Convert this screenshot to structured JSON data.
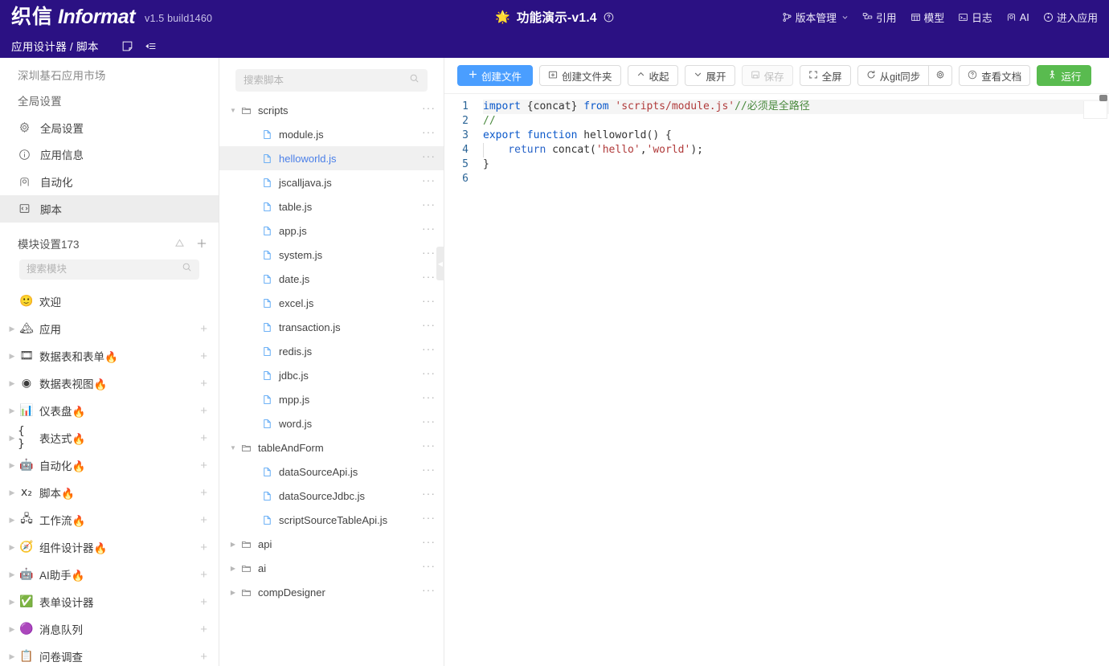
{
  "header": {
    "logo_cn": "织信",
    "logo_en": "Informat",
    "version": "v1.5 build1460",
    "center_star": "🌟",
    "center_title": "功能演示-v1.4",
    "help_icon": "help-circle-icon",
    "nav": [
      {
        "label": "版本管理",
        "icon": "branch-icon",
        "has_chevron": true
      },
      {
        "label": "引用",
        "icon": "reference-icon",
        "has_chevron": false
      },
      {
        "label": "模型",
        "icon": "model-table-icon",
        "has_chevron": false
      },
      {
        "label": "日志",
        "icon": "log-icon",
        "has_chevron": false
      },
      {
        "label": "AI",
        "icon": "ai-icon",
        "has_chevron": false
      },
      {
        "label": "进入应用",
        "icon": "enter-app-icon",
        "has_chevron": false
      }
    ],
    "brand_bg": "#2b1183"
  },
  "breadcrumb": {
    "text": "应用设计器 / 脚本",
    "icons": [
      "note-icon",
      "layout-toggle-icon"
    ]
  },
  "sidebar": {
    "market_name": "深圳基石应用市场",
    "section_label": "全局设置",
    "nav_items": [
      {
        "label": "全局设置",
        "icon": "gear-icon",
        "active": false
      },
      {
        "label": "应用信息",
        "icon": "info-icon",
        "active": false
      },
      {
        "label": "自动化",
        "icon": "robot-icon",
        "active": false
      },
      {
        "label": "脚本",
        "icon": "code-file-icon",
        "active": true
      }
    ],
    "modules_title": "模块设置173",
    "modules_head_icons": [
      "warning-triangle-icon",
      "plus-icon"
    ],
    "search_placeholder": "搜索模块",
    "search_value": "",
    "modules": [
      {
        "label": "欢迎",
        "emoji": "🙂",
        "caret": false,
        "plus": false
      },
      {
        "label": "应用",
        "emoji": "🏔",
        "caret": true,
        "plus": true
      },
      {
        "label": "数据表和表单🔥",
        "emoji": "🎞",
        "caret": true,
        "plus": true
      },
      {
        "label": "数据表视图🔥",
        "emoji": "◉",
        "caret": true,
        "plus": true
      },
      {
        "label": "仪表盘🔥",
        "emoji": "📊",
        "caret": true,
        "plus": true
      },
      {
        "label": "表达式🔥",
        "emoji": "{ }",
        "caret": true,
        "plus": true
      },
      {
        "label": "自动化🔥",
        "emoji": "🤖",
        "caret": true,
        "plus": true
      },
      {
        "label": "脚本🔥",
        "emoji": "x₂",
        "caret": true,
        "plus": true
      },
      {
        "label": "工作流🔥",
        "emoji": "🖧",
        "caret": true,
        "plus": true
      },
      {
        "label": "组件设计器🔥",
        "emoji": "🧭",
        "caret": true,
        "plus": true
      },
      {
        "label": "AI助手🔥",
        "emoji": "🤖",
        "caret": true,
        "plus": true
      },
      {
        "label": "表单设计器",
        "emoji": "✅",
        "caret": true,
        "plus": true
      },
      {
        "label": "消息队列",
        "emoji": "🟣",
        "caret": true,
        "plus": true
      },
      {
        "label": "问卷调查",
        "emoji": "📋",
        "caret": true,
        "plus": true
      }
    ]
  },
  "filetree": {
    "search_placeholder": "搜索脚本",
    "search_value": "",
    "nodes": [
      {
        "name": "scripts",
        "type": "folder",
        "depth": 0,
        "expanded": true,
        "selected": false
      },
      {
        "name": "module.js",
        "type": "file",
        "depth": 1,
        "selected": false
      },
      {
        "name": "helloworld.js",
        "type": "file",
        "depth": 1,
        "selected": true
      },
      {
        "name": "jscalljava.js",
        "type": "file",
        "depth": 1,
        "selected": false
      },
      {
        "name": "table.js",
        "type": "file",
        "depth": 1,
        "selected": false
      },
      {
        "name": "app.js",
        "type": "file",
        "depth": 1,
        "selected": false
      },
      {
        "name": "system.js",
        "type": "file",
        "depth": 1,
        "selected": false
      },
      {
        "name": "date.js",
        "type": "file",
        "depth": 1,
        "selected": false
      },
      {
        "name": "excel.js",
        "type": "file",
        "depth": 1,
        "selected": false
      },
      {
        "name": "transaction.js",
        "type": "file",
        "depth": 1,
        "selected": false
      },
      {
        "name": "redis.js",
        "type": "file",
        "depth": 1,
        "selected": false
      },
      {
        "name": "jdbc.js",
        "type": "file",
        "depth": 1,
        "selected": false
      },
      {
        "name": "mpp.js",
        "type": "file",
        "depth": 1,
        "selected": false
      },
      {
        "name": "word.js",
        "type": "file",
        "depth": 1,
        "selected": false
      },
      {
        "name": "tableAndForm",
        "type": "folder",
        "depth": 0,
        "expanded": true,
        "selected": false
      },
      {
        "name": "dataSourceApi.js",
        "type": "file",
        "depth": 1,
        "selected": false
      },
      {
        "name": "dataSourceJdbc.js",
        "type": "file",
        "depth": 1,
        "selected": false
      },
      {
        "name": "scriptSourceTableApi.js",
        "type": "file",
        "depth": 1,
        "selected": false
      },
      {
        "name": "api",
        "type": "folder",
        "depth": 0,
        "expanded": false,
        "selected": false
      },
      {
        "name": "ai",
        "type": "folder",
        "depth": 0,
        "expanded": false,
        "selected": false
      },
      {
        "name": "compDesigner",
        "type": "folder",
        "depth": 0,
        "expanded": false,
        "selected": false
      }
    ],
    "row_menu": "···"
  },
  "toolbar": {
    "create_file": "创建文件",
    "create_folder": "创建文件夹",
    "collapse": "收起",
    "expand": "展开",
    "save": "保存",
    "fullscreen": "全屏",
    "git_sync": "从git同步",
    "git_settings_icon": "gear-icon",
    "view_docs": "查看文档",
    "run": "运行",
    "primary_color": "#4a9eff",
    "success_color": "#59bb4f"
  },
  "editor": {
    "line_numbers": [
      "1",
      "2",
      "3",
      "4",
      "5",
      "6"
    ],
    "lines": [
      [
        {
          "t": "import ",
          "c": "kw"
        },
        {
          "t": "{concat} ",
          "c": "pl"
        },
        {
          "t": "from ",
          "c": "kw"
        },
        {
          "t": "'scripts/module.js'",
          "c": "str"
        },
        {
          "t": "//必须是全路径",
          "c": "cmt"
        }
      ],
      [
        {
          "t": "//",
          "c": "cmt"
        }
      ],
      [
        {
          "t": "export function ",
          "c": "kw"
        },
        {
          "t": "helloworld() {",
          "c": "pl"
        }
      ],
      [
        {
          "t": "    return ",
          "c": "kw2"
        },
        {
          "t": "concat(",
          "c": "pl"
        },
        {
          "t": "'hello'",
          "c": "str"
        },
        {
          "t": ",",
          "c": "pl"
        },
        {
          "t": "'world'",
          "c": "str"
        },
        {
          "t": ");",
          "c": "pl"
        }
      ],
      [
        {
          "t": "}",
          "c": "pl"
        }
      ],
      [
        {
          "t": "",
          "c": "pl"
        }
      ]
    ]
  }
}
